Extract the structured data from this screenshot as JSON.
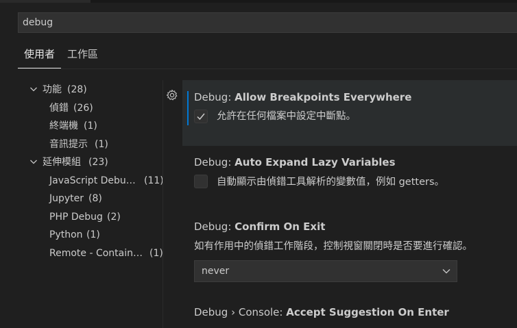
{
  "search": {
    "value": "debug"
  },
  "scope_tabs": [
    {
      "label": "使用者",
      "active": true
    },
    {
      "label": "工作區",
      "active": false
    }
  ],
  "toc": [
    {
      "label": "功能",
      "count": "(28)",
      "level": 0,
      "chevron": "chevron-down-icon"
    },
    {
      "label": "偵錯",
      "count": "(26)",
      "level": 1
    },
    {
      "label": "終端機",
      "count": "(1)",
      "level": 1
    },
    {
      "label": "音訊提示",
      "count": "(1)",
      "level": 1
    },
    {
      "label": "延伸模組",
      "count": "(23)",
      "level": 0,
      "chevron": "chevron-down-icon"
    },
    {
      "label": "JavaScript Debu…",
      "count": "(11)",
      "level": 1
    },
    {
      "label": "Jupyter",
      "count": "(8)",
      "level": 1
    },
    {
      "label": "PHP Debug",
      "count": "(2)",
      "level": 1
    },
    {
      "label": "Python",
      "count": "(1)",
      "level": 1
    },
    {
      "label": "Remote - Contain…",
      "count": "(1)",
      "level": 1
    }
  ],
  "settings": [
    {
      "category": "Debug: ",
      "name": "Allow Breakpoints Everywhere",
      "description": "允許在任何檔案中設定中斷點。",
      "type": "checkbox",
      "checked": true,
      "focused": true
    },
    {
      "category": "Debug: ",
      "name": "Auto Expand Lazy Variables",
      "description": "自動顯示由偵錯工具解析的變數值，例如 getters。",
      "type": "checkbox",
      "checked": false
    },
    {
      "category": "Debug: ",
      "name": "Confirm On Exit",
      "description": "如有作用中的偵錯工作階段，控制視窗關閉時是否要進行確認。",
      "type": "dropdown",
      "value": "never"
    },
    {
      "category": "Debug › Console: ",
      "name": "Accept Suggestion On Enter"
    }
  ],
  "colors": {
    "accent": "#0078d4",
    "background": "#1f1f1f",
    "focused_row": "#2a2d2e"
  }
}
